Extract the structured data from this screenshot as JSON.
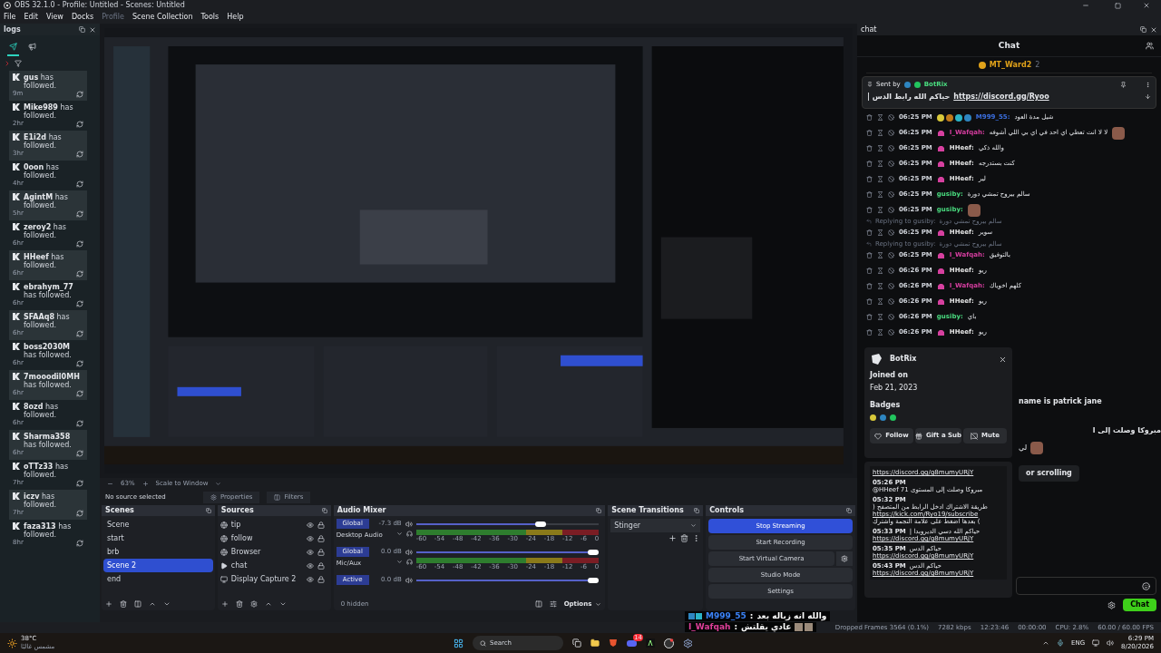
{
  "window": {
    "title": "OBS 32.1.0 - Profile: Untitled - Scenes: Untitled"
  },
  "menu": [
    {
      "label": "File",
      "disabled": false
    },
    {
      "label": "Edit",
      "disabled": false
    },
    {
      "label": "View",
      "disabled": false
    },
    {
      "label": "Docks",
      "disabled": false
    },
    {
      "label": "Profile",
      "disabled": true
    },
    {
      "label": "Scene Collection",
      "disabled": false
    },
    {
      "label": "Tools",
      "disabled": false
    },
    {
      "label": "Help",
      "disabled": false
    }
  ],
  "logs_dock": {
    "title": "logs",
    "tabs": [
      {
        "kind": "send",
        "selected": true
      },
      {
        "kind": "announce",
        "selected": false
      }
    ],
    "events": [
      {
        "name": "gus",
        "text": "has followed.",
        "time": "9m"
      },
      {
        "name": "Mike989",
        "text": "has followed.",
        "time": "2hr"
      },
      {
        "name": "E1i2d",
        "text": "has followed.",
        "time": "3hr"
      },
      {
        "name": "0oon",
        "text": "has followed.",
        "time": "4hr"
      },
      {
        "name": "AgintM",
        "text": "has followed.",
        "time": "5hr"
      },
      {
        "name": "zeroy2",
        "text": "has followed.",
        "time": "6hr"
      },
      {
        "name": "HHeef",
        "text": "has followed.",
        "time": "6hr"
      },
      {
        "name": "ebrahym_77",
        "text": "has followed.",
        "time": "6hr"
      },
      {
        "name": "SFAAq8",
        "text": "has followed.",
        "time": "6hr"
      },
      {
        "name": "boss2030M",
        "text": "has followed.",
        "time": "6hr"
      },
      {
        "name": "7mooodil0MH",
        "text": "has followed.",
        "time": "6hr"
      },
      {
        "name": "8ozd",
        "text": "has followed.",
        "time": "6hr"
      },
      {
        "name": "Sharma358",
        "text": "has followed.",
        "time": "6hr"
      },
      {
        "name": "oTTz33",
        "text": "has followed.",
        "time": "7hr"
      },
      {
        "name": "iczv",
        "text": "has followed.",
        "time": "7hr"
      },
      {
        "name": "faza313",
        "text": "has followed.",
        "time": "8hr"
      }
    ]
  },
  "preview": {
    "kind": "picture",
    "zoom": "63%",
    "scale_mode": "Scale to Window"
  },
  "source_bar": {
    "status": "No source selected",
    "properties": "Properties",
    "filters": "Filters"
  },
  "scenes": {
    "title": "Scenes",
    "items": [
      {
        "label": "Scene",
        "selected": false
      },
      {
        "label": "start",
        "selected": false
      },
      {
        "label": "brb",
        "selected": false
      },
      {
        "label": "Scene 2",
        "selected": true
      },
      {
        "label": "end",
        "selected": false
      }
    ]
  },
  "sources": {
    "title": "Sources",
    "items": [
      {
        "label": "tip",
        "kind": "browser"
      },
      {
        "label": "follow",
        "kind": "browser"
      },
      {
        "label": "Browser",
        "kind": "browser"
      },
      {
        "label": "chat",
        "kind": "media"
      },
      {
        "label": "Display Capture 2",
        "kind": "display"
      }
    ]
  },
  "audio_mixer": {
    "title": "Audio Mixer",
    "hidden": "0 hidden",
    "options": "Options",
    "channels": [
      {
        "mode": "Global",
        "reading": "-7.3 dB",
        "name": "Desktop Audio",
        "level": 0.71,
        "scale": [
          "-60",
          "-54",
          "-48",
          "-42",
          "-36",
          "-30",
          "-24",
          "-18",
          "-12",
          "-6",
          "0"
        ]
      },
      {
        "mode": "Global",
        "reading": "0.0 dB",
        "name": "Mic/Aux",
        "level": 1,
        "scale": [
          "-60",
          "-54",
          "-48",
          "-42",
          "-36",
          "-30",
          "-24",
          "-18",
          "-12",
          "-6",
          "0"
        ]
      },
      {
        "mode": "Active",
        "reading": "0.0 dB",
        "level": 1
      }
    ]
  },
  "scene_transitions": {
    "title": "Scene Transitions",
    "transition": "Stinger"
  },
  "controls": {
    "title": "Controls",
    "buttons": [
      {
        "label": "Stop Streaming",
        "active": true
      },
      {
        "label": "Start Recording",
        "active": false
      },
      {
        "label": "Start Virtual Camera",
        "active": false
      },
      {
        "label": "Studio Mode",
        "active": false
      },
      {
        "label": "Settings",
        "active": false
      }
    ]
  },
  "chat_dock": {
    "dock_title": "chat",
    "title": "Chat",
    "top_gifter": {
      "name": "MT_Ward2",
      "count": "2"
    },
    "pinned": {
      "sent_by": "Sent by",
      "author": "BotRix",
      "text": "حياكم الله رابط الدس |",
      "link": "https://discord.gg/Ryoo"
    },
    "messages": [
      {
        "kind": "message",
        "time": "06:25 PM",
        "user": "M999_55:",
        "color": "#3b6fe0",
        "subscriber": false,
        "badges": true,
        "emote": false,
        "text": "شيل مدة العود"
      },
      {
        "kind": "message",
        "time": "06:25 PM",
        "user": "I_Wafqah:",
        "color": "#d43d9e",
        "subscriber": true,
        "badges": false,
        "emote": true,
        "text": "لا لا انت تعطي اي احد في اي بي اللي أشوفه"
      },
      {
        "kind": "message",
        "time": "06:25 PM",
        "user": "HHeef:",
        "color": "#e5e5e5",
        "subscriber": true,
        "badges": false,
        "emote": false,
        "text": "والله ذكي"
      },
      {
        "kind": "message",
        "time": "06:25 PM",
        "user": "HHeef:",
        "color": "#e5e5e5",
        "subscriber": true,
        "badges": false,
        "emote": false,
        "text": "كنت بستدرجه"
      },
      {
        "kind": "message",
        "time": "06:25 PM",
        "user": "HHeef:",
        "color": "#e5e5e5",
        "subscriber": true,
        "badges": false,
        "emote": false,
        "text": "لير"
      },
      {
        "kind": "message",
        "time": "06:25 PM",
        "user": "gusiby:",
        "color": "#4ade80",
        "subscriber": false,
        "badges": false,
        "emote": false,
        "text": "سالم بيروح تمشي دورة"
      },
      {
        "kind": "message",
        "time": "06:25 PM",
        "user": "gusiby:",
        "color": "#4ade80",
        "subscriber": false,
        "badges": false,
        "emote": true
      },
      {
        "kind": "reply",
        "text": "Replying to gusiby:",
        "quote": "سالم بيروح تمشي دورة"
      },
      {
        "kind": "message",
        "time": "06:25 PM",
        "user": "HHeef:",
        "color": "#e5e5e5",
        "subscriber": true,
        "badges": false,
        "emote": false,
        "text": "سوير"
      },
      {
        "kind": "reply",
        "text": "Replying to gusiby:",
        "quote": "سالم بيروح تمشي دورة"
      },
      {
        "kind": "message",
        "time": "06:25 PM",
        "user": "I_Wafqah:",
        "color": "#d43d9e",
        "subscriber": true,
        "badges": false,
        "emote": false,
        "text": "بالتوفيق"
      },
      {
        "kind": "message",
        "time": "06:26 PM",
        "user": "HHeef:",
        "color": "#e5e5e5",
        "subscriber": true,
        "badges": false,
        "emote": false,
        "text": "ريو"
      },
      {
        "kind": "message",
        "time": "06:26 PM",
        "user": "I_Wafqah:",
        "color": "#d43d9e",
        "subscriber": true,
        "badges": false,
        "emote": false,
        "text": "كلهم اخوياك"
      },
      {
        "kind": "message",
        "time": "06:26 PM",
        "user": "HHeef:",
        "color": "#e5e5e5",
        "subscriber": true,
        "badges": false,
        "emote": false,
        "text": "ريو"
      },
      {
        "kind": "message",
        "time": "06:26 PM",
        "user": "gusiby:",
        "color": "#4ade80",
        "subscriber": false,
        "badges": false,
        "emote": false,
        "text": "باي"
      },
      {
        "kind": "message",
        "time": "06:26 PM",
        "user": "HHeef:",
        "color": "#e5e5e5",
        "subscriber": true,
        "badges": false,
        "emote": false,
        "text": "ريو"
      }
    ],
    "partial_lines": [
      {
        "kind": "text",
        "text": "name is patrick jane"
      },
      {
        "kind": "text",
        "text": "مبروكا وصلت إلى ا"
      },
      {
        "kind": "emote",
        "text": "لي"
      },
      {
        "kind": "pill",
        "text": "or scrolling"
      }
    ],
    "send_button": "Chat"
  },
  "botrix_popup": {
    "name": "BotRix",
    "joined_label": "Joined on",
    "joined": "Feb 21, 2023",
    "badges_label": "Badges",
    "buttons": [
      "Follow",
      "Gift a Sub",
      "Mute"
    ],
    "history": [
      {
        "parts": [
          {
            "kind": "link",
            "text": "https://discord.gg/g8mumyURjY"
          }
        ]
      },
      {
        "time": "05:26 PM",
        "parts": [
          {
            "kind": "text",
            "text": "@HHeef مبروكا وصلت إلى المستوى 71"
          }
        ]
      },
      {
        "time": "05:32 PM",
        "parts": [
          {
            "kind": "text",
            "text": "طريقة الاشتراك ادخل الرابط من المتصفح ("
          },
          {
            "kind": "link",
            "text": "https://kick.com/Ryo19/subscribe"
          },
          {
            "kind": "text",
            "text": ") بعدها اضغط على علامة النجمة واشترك"
          }
        ]
      },
      {
        "time": "05:33 PM",
        "parts": [
          {
            "kind": "text",
            "text": "حياكم الله دسي الديروبدا |"
          },
          {
            "kind": "link",
            "text": "https://discord.gg/g8mumyURjY"
          }
        ]
      },
      {
        "time": "05:35 PM",
        "parts": [
          {
            "kind": "text",
            "text": "حياكم الدس"
          },
          {
            "kind": "link",
            "text": "https://discord.gg/g8mumyURjY"
          }
        ]
      },
      {
        "time": "05:43 PM",
        "parts": [
          {
            "kind": "text",
            "text": "حياكم الدس"
          },
          {
            "kind": "link",
            "text": "https://discord.gg/g8mumyURjY"
          }
        ]
      }
    ]
  },
  "overlay_messages": [
    {
      "user": "M999_55",
      "color": "#3b82f6",
      "separator": ":",
      "text": "والله انه زباله بعد",
      "badges": true,
      "emote": false
    },
    {
      "user": "I_Wafqah",
      "color": "#e0409a",
      "separator": ":",
      "text": "عادي يقلتش",
      "badges": false,
      "emote": true
    }
  ],
  "status_bar": [
    "Dropped Frames 3564 (0.1%)",
    "7282 kbps",
    "12:23:46",
    "00:00:00",
    "CPU: 2.8%",
    "60.00 / 60.00 FPS"
  ],
  "taskbar": {
    "temperature": "38°C",
    "weather": "مشمس غالبًا",
    "search": "Search",
    "discord_badge": "14",
    "language": "ENG",
    "time": "6:29 PM",
    "date": "8/20/2026"
  }
}
